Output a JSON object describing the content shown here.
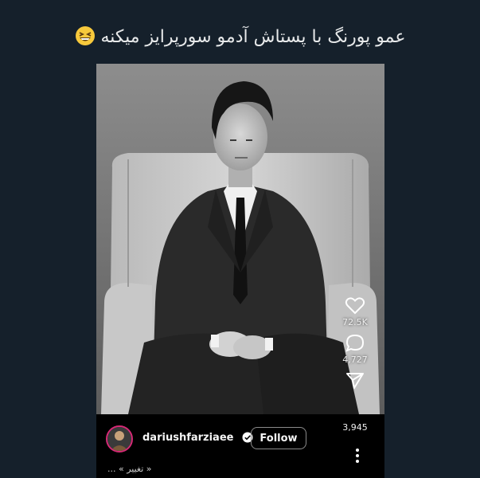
{
  "tweet": {
    "text": "عمو پورنگ با پستاش آدمو سورپرایز میکنه"
  },
  "reel": {
    "username": "dariushfarziaee",
    "follow_label": "Follow",
    "likes": "72.5K",
    "comments": "4,727",
    "shares": "3,945",
    "caption": "« تغییر » ..."
  },
  "icons": {
    "emoji": "grinning-squinting-face",
    "like": "heart-icon",
    "comment": "comment-bubble-icon",
    "share": "paper-plane-icon",
    "verified": "verified-badge-icon",
    "more": "more-vertical-icon"
  },
  "colors": {
    "background": "#15202b",
    "text": "#e7e9ea",
    "reel_bg": "#000000",
    "story_ring": "#d62976"
  }
}
